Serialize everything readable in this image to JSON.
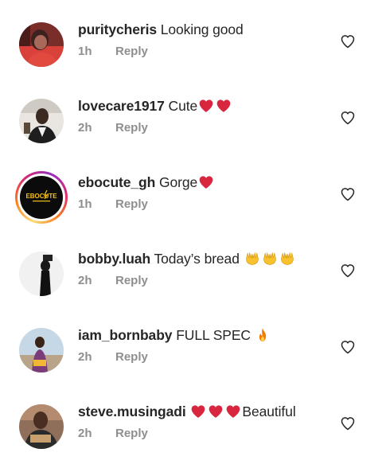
{
  "comments": [
    {
      "username": "puritycheris",
      "text": "Looking good",
      "time": "1h",
      "reply_label": "Reply",
      "emoji": []
    },
    {
      "username": "lovecare1917",
      "text": "Cute",
      "time": "2h",
      "reply_label": "Reply",
      "emoji": [
        "red-heart",
        "red-heart"
      ]
    },
    {
      "username": "ebocute_gh",
      "text": "Gorge",
      "time": "1h",
      "reply_label": "Reply",
      "emoji": [
        "red-heart"
      ],
      "avatar_label": "EBOCUTE"
    },
    {
      "username": "bobby.luah",
      "text": "Today’s bread",
      "time": "2h",
      "reply_label": "Reply",
      "emoji": [
        "raising-hands",
        "raising-hands",
        "raising-hands"
      ]
    },
    {
      "username": "iam_bornbaby",
      "text": "FULL SPEC",
      "time": "2h",
      "reply_label": "Reply",
      "emoji": [
        "fire"
      ]
    },
    {
      "username": "steve.musingadi",
      "text": "Beautiful",
      "time": "2h",
      "reply_label": "Reply",
      "emoji_before": [
        "red-heart",
        "red-heart",
        "red-heart"
      ]
    }
  ],
  "colors": {
    "text": "#262626",
    "meta": "#8e8e8e",
    "heart_emoji": "#d7263d",
    "like_icon_stroke": "#262626"
  }
}
